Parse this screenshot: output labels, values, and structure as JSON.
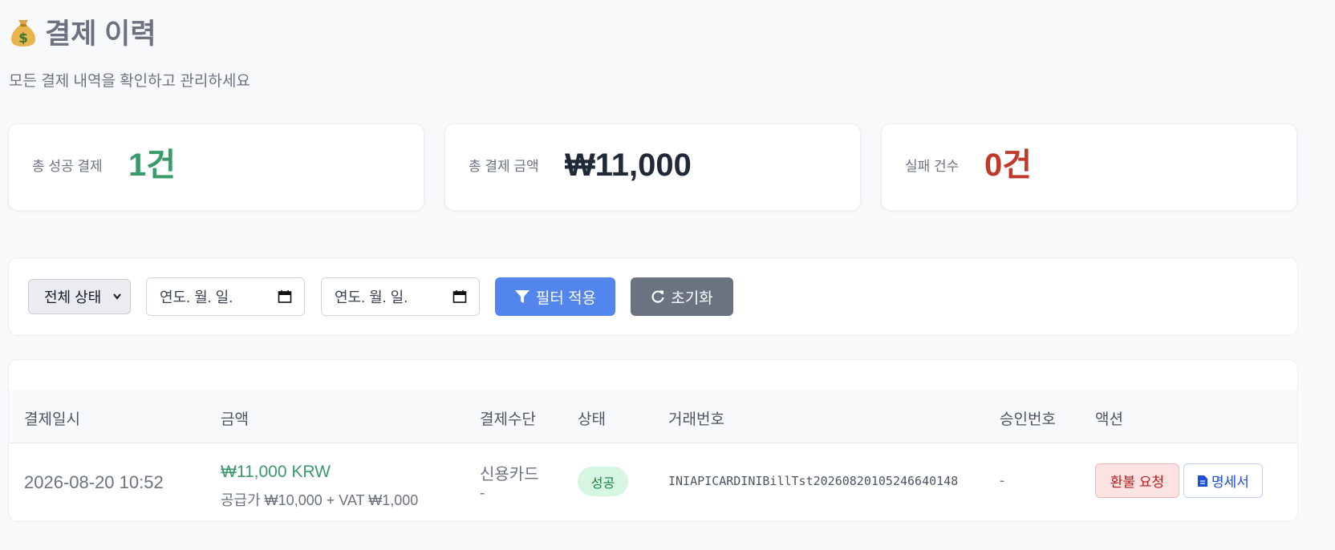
{
  "header": {
    "icon": "money-bag-icon",
    "title": "결제 이력",
    "subtitle": "모든 결제 내역을 확인하고 관리하세요"
  },
  "stats": [
    {
      "label": "총 성공 결제",
      "value": "1건",
      "color": "#3a9a6a"
    },
    {
      "label": "총 결제 금액",
      "value": "₩11,000",
      "color": "#1f2937"
    },
    {
      "label": "실패 건수",
      "value": "0건",
      "color": "#c0392b"
    }
  ],
  "filters": {
    "status_selected": "전체 상태",
    "start_date_placeholder": "연도. 월. 일.",
    "end_date_placeholder": "연도. 월. 일.",
    "apply_label": "필터 적용",
    "reset_label": "초기화"
  },
  "table": {
    "headers": [
      "결제일시",
      "금액",
      "결제수단",
      "상태",
      "거래번호",
      "승인번호",
      "액션"
    ],
    "rows": [
      {
        "datetime": "2026-08-20 10:52",
        "amount": "₩11,000 KRW",
        "amount_detail": "공급가 ₩10,000 + VAT ₩1,000",
        "method": "신용카드",
        "method_detail": "-",
        "status": "성공",
        "transaction_id": "INIAPICARDINIBillTst20260820105246640148",
        "approval_no": "-",
        "refund_label": "환불 요청",
        "receipt_label": "명세서"
      }
    ]
  },
  "colors": {
    "accent": "#5285ee",
    "success": "#3a9a6a",
    "danger": "#c0392b",
    "neutral_button": "#6b7280"
  }
}
